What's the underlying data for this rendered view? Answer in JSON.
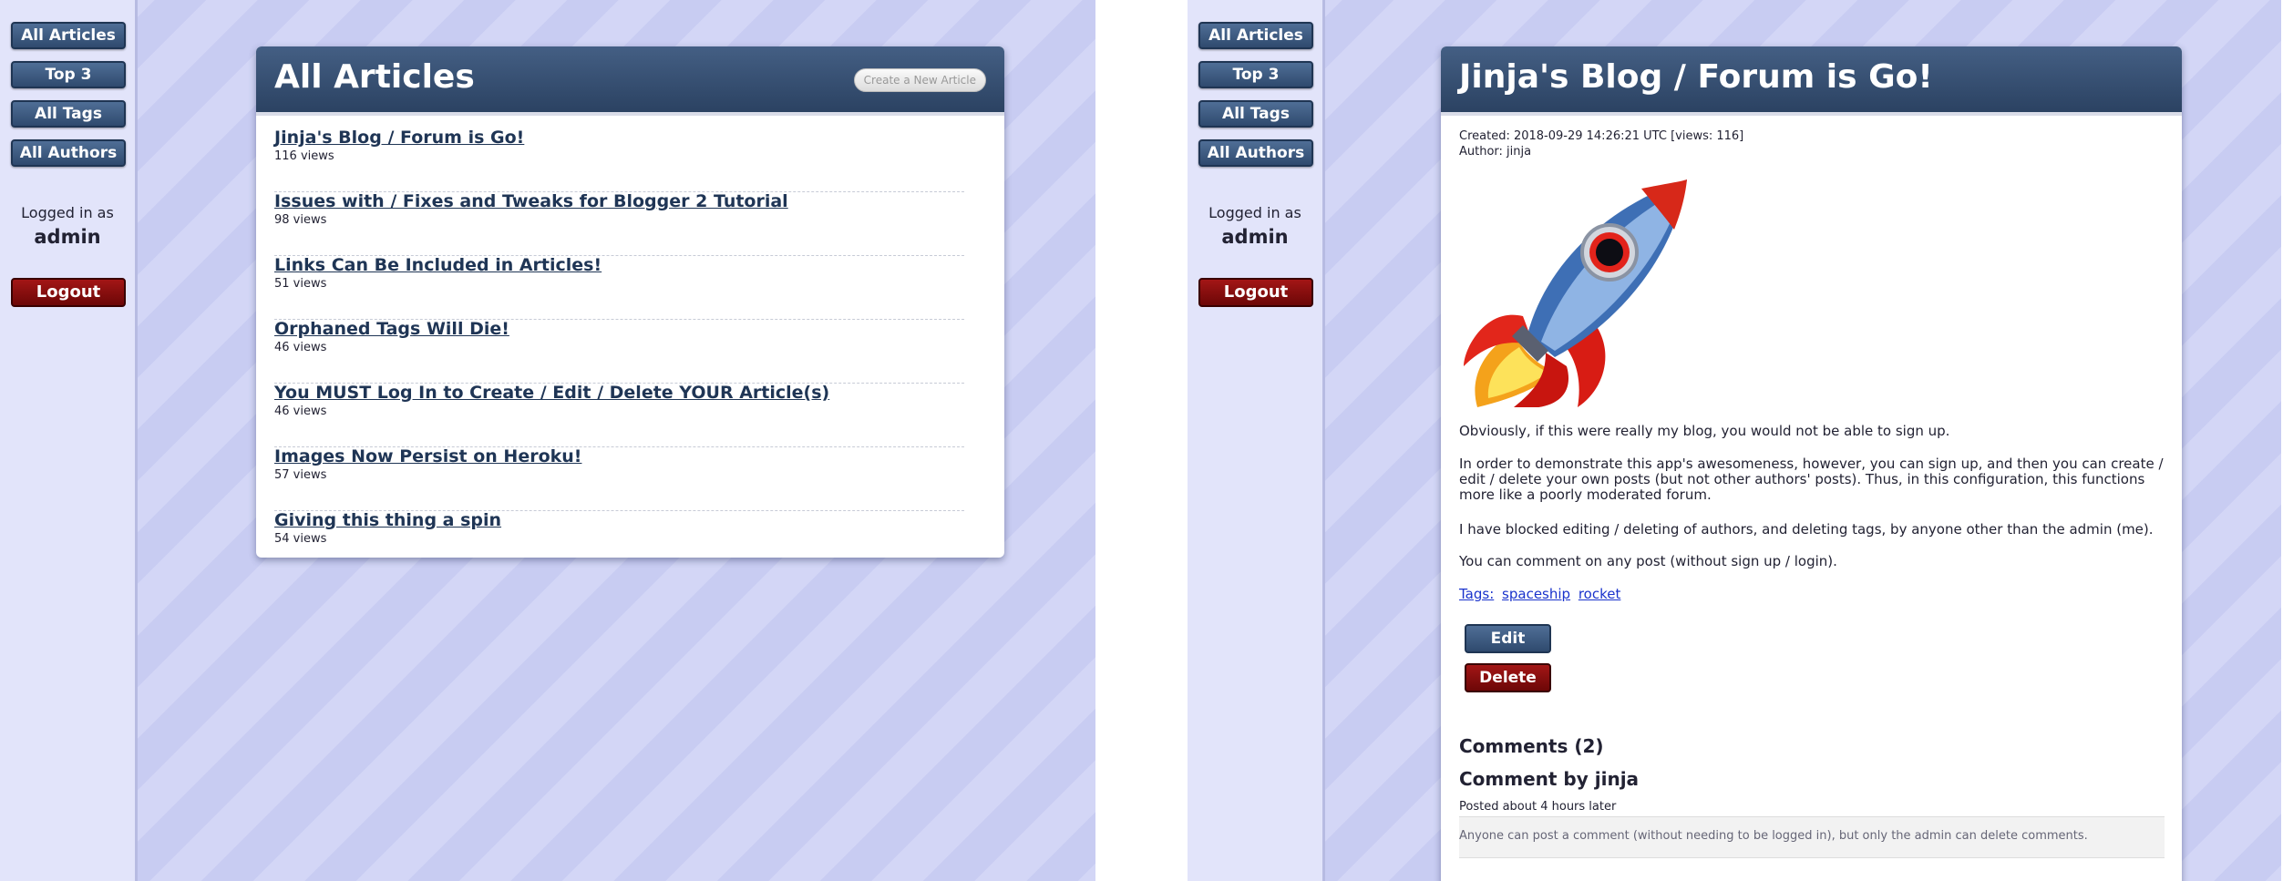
{
  "nav": {
    "all_articles": "All Articles",
    "top3": "Top 3",
    "all_tags": "All Tags",
    "all_authors": "All Authors",
    "logged_in_label": "Logged in as",
    "user": "admin",
    "logout": "Logout"
  },
  "list_page": {
    "title": "All Articles",
    "create_button": "Create a New Article",
    "articles": [
      {
        "title": "Jinja's Blog / Forum is Go!",
        "views": "116 views"
      },
      {
        "title": "Issues with / Fixes and Tweaks for Blogger 2 Tutorial",
        "views": "98 views"
      },
      {
        "title": "Links Can Be Included in Articles!",
        "views": "51 views"
      },
      {
        "title": "Orphaned Tags Will Die!",
        "views": "46 views"
      },
      {
        "title": "You MUST Log In to Create / Edit / Delete YOUR Article(s)",
        "views": "46 views"
      },
      {
        "title": "Images Now Persist on Heroku!",
        "views": "57 views"
      },
      {
        "title": "Giving this thing a spin",
        "views": "54 views"
      }
    ]
  },
  "article_page": {
    "title": "Jinja's Blog / Forum is Go!",
    "created": "Created: 2018-09-29 14:26:21 UTC [views: 116]",
    "author": "Author: jinja",
    "image_icon": "rocket-icon",
    "paragraphs": [
      "Obviously, if this were really my blog, you would not be able to sign up.",
      "In order to demonstrate this app's awesomeness, however, you can sign up, and then you can create / edit / delete your own posts (but not other authors' posts). Thus, in this configuration, this functions more like a poorly moderated forum.",
      "I have blocked editing / deleting of authors, and deleting tags, by anyone other than the admin (me).",
      "You can comment on any post (without sign up / login)."
    ],
    "tags_label": "Tags:",
    "tags": [
      "spaceship",
      "rocket"
    ],
    "edit": "Edit",
    "delete": "Delete",
    "comments_heading": "Comments (2)",
    "comment": {
      "author": "Comment by jinja",
      "posted": "Posted about 4 hours later",
      "body": "Anyone can post a comment (without needing to be logged in), but only the admin can delete comments."
    }
  },
  "colors": {
    "background": "#d3d6f6",
    "header": "#2b4262",
    "danger": "#8b0d0d",
    "link": "#1a33cc"
  }
}
